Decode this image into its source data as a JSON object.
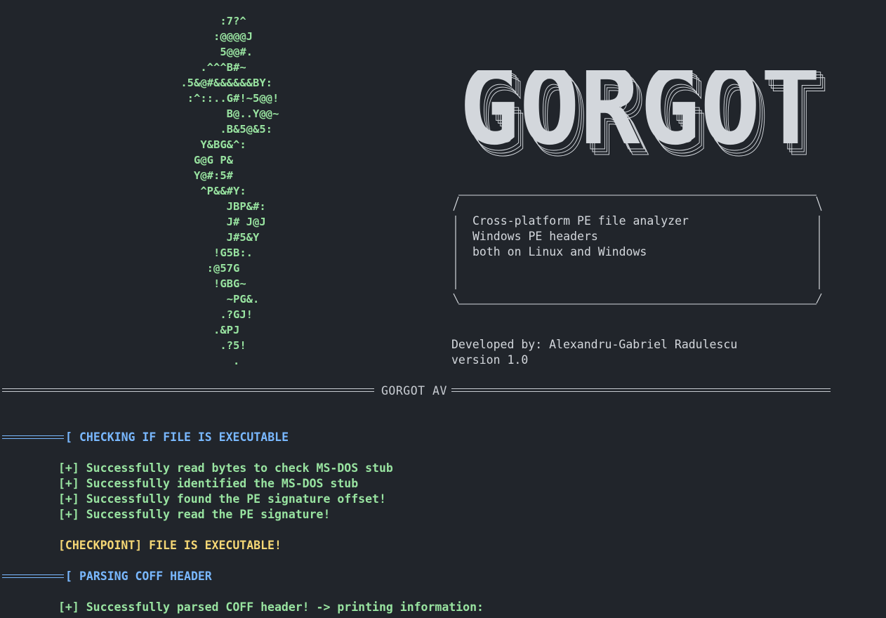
{
  "ascii_art": [
    "       :7?^",
    "      :@@@@J",
    "       5@@#.",
    "    .^^^B#~",
    " .5&@#&&&&&&BY:",
    "  :^::..G#!~5@@!",
    "        B@..Y@@~",
    "       .B&5@&5:",
    "    Y&BG&^:",
    "   G@G P&",
    "   Y@#:5#",
    "    ^P&&#Y:",
    "        JBP&#:",
    "        J# J@J",
    "        J#5&Y",
    "      !G5B:.",
    "     :@57G",
    "      !GBG~",
    "        ~PG&.",
    "       .?GJ!",
    "      .&PJ",
    "       .?5!",
    "         ."
  ],
  "logo_text": "GORGOT",
  "box": {
    "top": " ____________________________________________________",
    "lines": [
      "Cross-platform PE file analyzer",
      "Windows PE headers",
      "both on Linux and Windows"
    ]
  },
  "credits": {
    "developer": "Developed by: Alexandru-Gabriel Radulescu",
    "version": "version 1.0"
  },
  "divider_title": "GORGOT AV",
  "sections": [
    {
      "bracket": "[",
      "title": "CHECKING IF FILE IS EXECUTABLE",
      "logs": [
        "[+] Successfully read bytes to check MS-DOS stub",
        "[+] Successfully identified the MS-DOS stub",
        "[+] Successfully found the PE signature offset!",
        "[+] Successfully read the PE signature!"
      ],
      "checkpoint": "[CHECKPOINT] FILE IS EXECUTABLE!"
    },
    {
      "bracket": "[",
      "title": "PARSING COFF HEADER",
      "logs": [
        "[+] Successfully parsed COFF header! -> printing information:"
      ]
    }
  ],
  "colors": {
    "background": "#21252b",
    "art_green": "#98e3a0",
    "section_blue": "#79b8ff",
    "checkpoint_yellow": "#f5d775",
    "text": "#d3d7dc"
  }
}
